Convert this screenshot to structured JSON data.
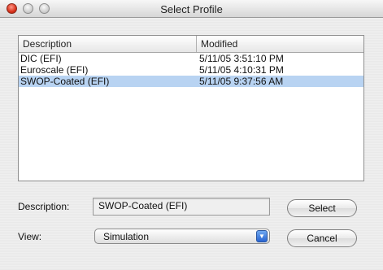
{
  "window": {
    "title": "Select Profile"
  },
  "table": {
    "columns": [
      "Description",
      "Modified"
    ],
    "rows": [
      {
        "description": "DIC (EFI)",
        "modified": "5/11/05 3:51:10 PM",
        "selected": false
      },
      {
        "description": "Euroscale (EFI)",
        "modified": "5/11/05 4:10:31 PM",
        "selected": false
      },
      {
        "description": "SWOP-Coated (EFI)",
        "modified": "5/11/05 9:37:56 AM",
        "selected": true
      }
    ]
  },
  "form": {
    "description_label": "Description:",
    "description_value": "SWOP-Coated (EFI)",
    "view_label": "View:",
    "view_value": "Simulation"
  },
  "buttons": {
    "select": "Select",
    "cancel": "Cancel"
  },
  "colors": {
    "selection": "#b8d3f2",
    "close_button": "#d8311b",
    "popup_arrow": "#2864d2"
  }
}
